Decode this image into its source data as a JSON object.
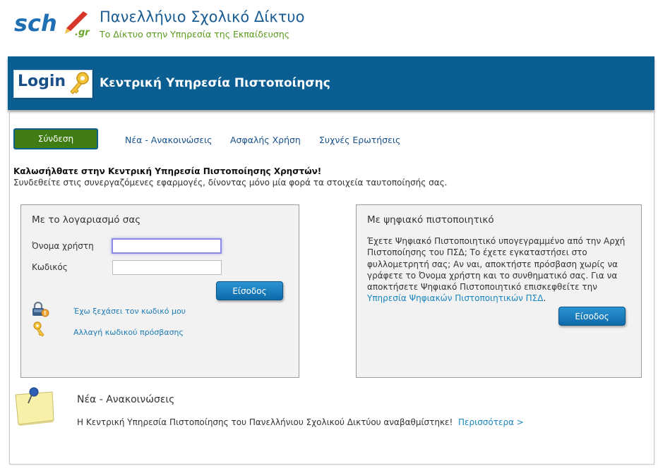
{
  "header": {
    "title": "Πανελλήνιο Σχολικό Δίκτυο",
    "subtitle": "Το Δίκτυο στην Υπηρεσία της Εκπαίδευσης",
    "logo_text": "sch.gr"
  },
  "banner": {
    "login_badge": "Login",
    "title": "Κεντρική Υπηρεσία Πιστοποίησης"
  },
  "tabs": [
    {
      "label": "Σύνδεση",
      "active": true
    },
    {
      "label": "Νέα - Ανακοινώσεις",
      "active": false
    },
    {
      "label": "Ασφαλής Χρήση",
      "active": false
    },
    {
      "label": "Συχνές Ερωτήσεις",
      "active": false
    }
  ],
  "welcome": {
    "heading": "Καλωσήλθατε στην Κεντρική Υπηρεσία Πιστοποίησης Χρηστών!",
    "text": "Συνδεθείτε στις συνεργαζόμενες εφαρμογές, δίνοντας μόνο μία φορά τα στοιχεία ταυτοποίησής σας."
  },
  "account_panel": {
    "title": "Με το λογαριασμό σας",
    "username_label": "Όνομα χρήστη",
    "username_value": "",
    "password_label": "Κωδικός",
    "password_value": "",
    "submit_label": "Είσοδος",
    "forgot_link": "Έχω ξεχάσει τον κωδικό μου",
    "change_link": "Αλλαγή κωδικού πρόσβασης"
  },
  "certificate_panel": {
    "title": "Με ψηφιακό πιστοποιητικό",
    "text": "Έχετε Ψηφιακό Πιστοποιητικό υπογεγραμμένο από την Αρχή Πιστοποίησης του ΠΣΔ; Το έχετε εγκαταστήσει στο φυλλομετρητή σας; Αν ναι, αποκτήστε πρόσβαση χωρίς να γράφετε το Όνομα χρήστη και το συνθηματικό σας. Για να αποκτήσετε Ψηφιακό Πιστοποιητικό επισκεφθείτε την ",
    "link": "Υπηρεσία Ψηφιακών Πιστοποιητικών ΠΣΔ",
    "text_end": ".",
    "submit_label": "Είσοδος"
  },
  "news": {
    "title": "Νέα - Ανακοινώσεις",
    "text": "Η Κεντρική Υπηρεσία Πιστοποίησης του Πανελλήνιου Σχολικού Δικτύου αναβαθμίστηκε!",
    "more_link": "Περισσότερα >"
  },
  "icons": {
    "logo": "sch-logo-icon",
    "login": "login-key-icon",
    "lock": "lock-icon",
    "key": "key-icon",
    "note": "pinned-note-icon"
  },
  "colors": {
    "banner": "#0b5e92",
    "active_tab": "#3f7d14",
    "title_blue": "#1a5c94",
    "subtitle_green": "#5a9a1c",
    "button_blue": "#1a7fc0"
  }
}
